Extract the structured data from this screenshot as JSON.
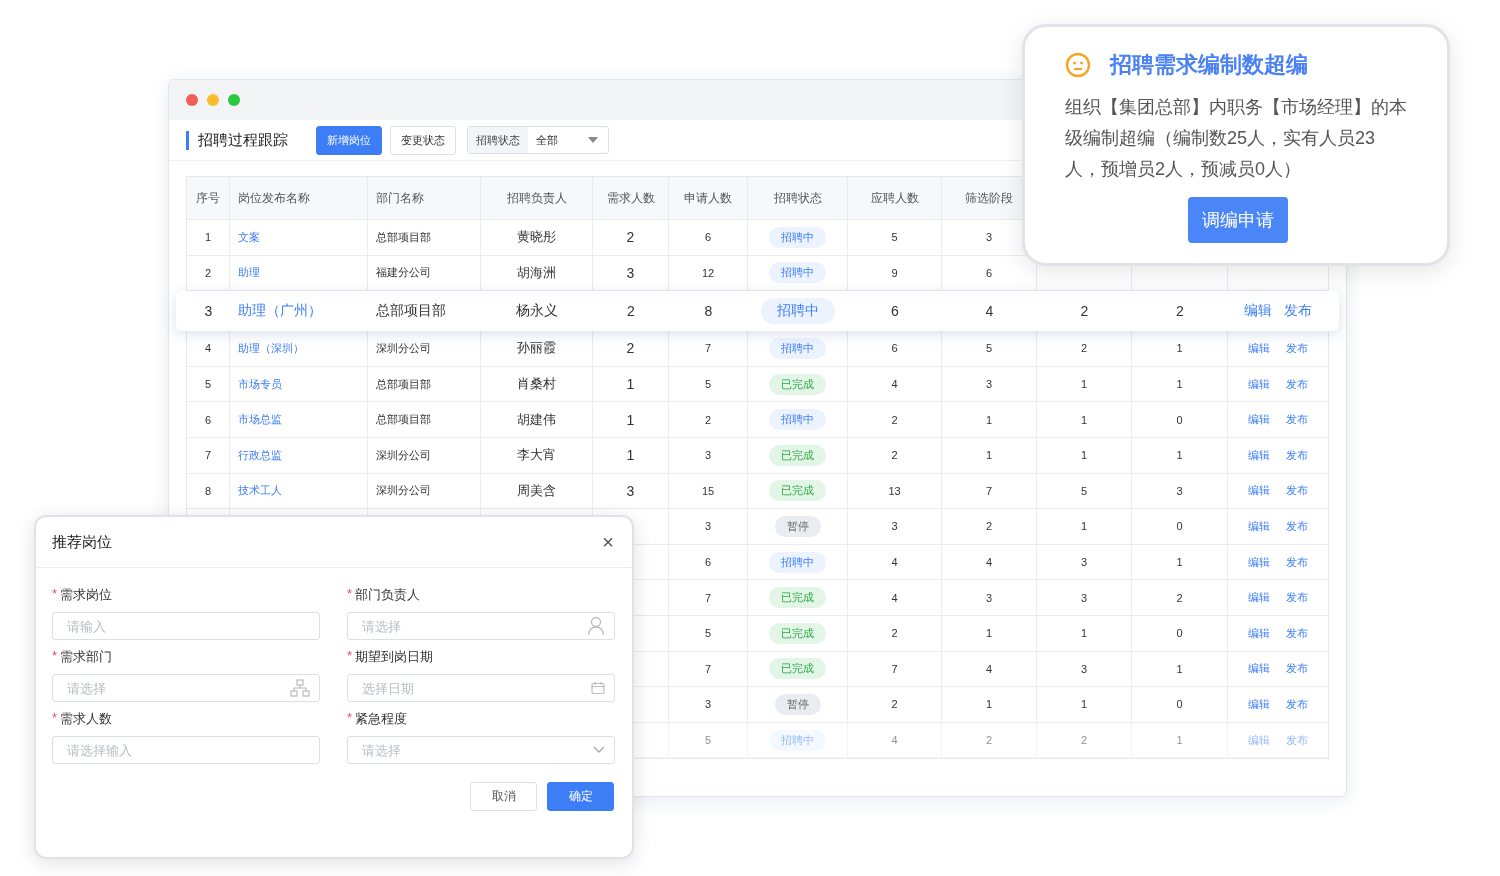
{
  "main_window": {
    "title": "招聘过程跟踪",
    "toolbar": {
      "buttons": [
        {
          "label": "新增岗位",
          "kind": "primary"
        },
        {
          "label": "变更状态",
          "kind": "default"
        }
      ],
      "filter": {
        "label": "招聘状态",
        "value": "全部"
      }
    },
    "table": {
      "columns": [
        "序号",
        "岗位发布名称",
        "部门名称",
        "招聘负责人",
        "需求人数",
        "申请人数",
        "招聘状态",
        "应聘人数",
        "筛选阶段"
      ],
      "rows": [
        {
          "no": "1",
          "name": "文案",
          "dept": "总部项目部",
          "owner": "黄晓彤",
          "demand": "2",
          "applied": "6",
          "status": {
            "text": "招聘中",
            "kind": "active"
          },
          "applicants": "5",
          "screening": "3",
          "featured": false,
          "dimmed": false
        },
        {
          "no": "2",
          "name": "助理",
          "dept": "福建分公司",
          "owner": "胡海洲",
          "demand": "3",
          "applied": "12",
          "status": {
            "text": "招聘中",
            "kind": "active"
          },
          "applicants": "9",
          "screening": "6",
          "featured": false,
          "dimmed": false
        },
        {
          "no": "3",
          "name": "助理（广州）",
          "dept": "总部项目部",
          "owner": "杨永义",
          "demand": "2",
          "applied": "8",
          "status": {
            "text": "招聘中",
            "kind": "active"
          },
          "applicants": "6",
          "screening": "4",
          "column_10": "2",
          "column_11": "2",
          "actions": [
            "编辑",
            "发布"
          ],
          "featured": true,
          "dimmed": false
        },
        {
          "no": "4",
          "name": "助理（深圳）",
          "dept": "深圳分公司",
          "owner": "孙丽霞",
          "demand": "2",
          "applied": "7",
          "status": {
            "text": "招聘中",
            "kind": "active"
          },
          "applicants": "6",
          "screening": "5",
          "column_10": "2",
          "column_11": "1",
          "actions": [
            "编辑",
            "发布"
          ],
          "featured": false,
          "dimmed": false
        },
        {
          "no": "5",
          "name": "市场专员",
          "dept": "总部项目部",
          "owner": "肖桑村",
          "demand": "1",
          "applied": "5",
          "status": {
            "text": "已完成",
            "kind": "done"
          },
          "applicants": "4",
          "screening": "3",
          "column_10": "1",
          "column_11": "1",
          "actions": [
            "编辑",
            "发布"
          ],
          "featured": false,
          "dimmed": false
        },
        {
          "no": "6",
          "name": "市场总监",
          "dept": "总部项目部",
          "owner": "胡建伟",
          "demand": "1",
          "applied": "2",
          "status": {
            "text": "招聘中",
            "kind": "active"
          },
          "applicants": "2",
          "screening": "1",
          "column_10": "1",
          "column_11": "0",
          "actions": [
            "编辑",
            "发布"
          ],
          "featured": false,
          "dimmed": false
        },
        {
          "no": "7",
          "name": "行政总监",
          "dept": "深圳分公司",
          "owner": "李大宵",
          "demand": "1",
          "applied": "3",
          "status": {
            "text": "已完成",
            "kind": "done"
          },
          "applicants": "2",
          "screening": "1",
          "column_10": "1",
          "column_11": "1",
          "actions": [
            "编辑",
            "发布"
          ],
          "featured": false,
          "dimmed": false
        },
        {
          "no": "8",
          "name": "技术工人",
          "dept": "深圳分公司",
          "owner": "周美含",
          "demand": "3",
          "applied": "15",
          "status": {
            "text": "已完成",
            "kind": "done"
          },
          "applicants": "13",
          "screening": "7",
          "column_10": "5",
          "column_11": "3",
          "actions": [
            "编辑",
            "发布"
          ],
          "featured": false,
          "dimmed": false
        },
        {
          "applied": "3",
          "status": {
            "text": "暂停",
            "kind": "paused"
          },
          "applicants": "3",
          "screening": "2",
          "column_10": "1",
          "column_11": "0",
          "actions": [
            "编辑",
            "发布"
          ],
          "featured": false,
          "dimmed": false
        },
        {
          "applied": "6",
          "status": {
            "text": "招聘中",
            "kind": "active"
          },
          "applicants": "4",
          "screening": "4",
          "column_10": "3",
          "column_11": "1",
          "actions": [
            "编辑",
            "发布"
          ],
          "featured": false,
          "dimmed": false
        },
        {
          "applied": "7",
          "status": {
            "text": "已完成",
            "kind": "done"
          },
          "applicants": "4",
          "screening": "3",
          "column_10": "3",
          "column_11": "2",
          "actions": [
            "编辑",
            "发布"
          ],
          "featured": false,
          "dimmed": false
        },
        {
          "applied": "5",
          "status": {
            "text": "已完成",
            "kind": "done"
          },
          "applicants": "2",
          "screening": "1",
          "column_10": "1",
          "column_11": "0",
          "actions": [
            "编辑",
            "发布"
          ],
          "featured": false,
          "dimmed": false
        },
        {
          "applied": "7",
          "status": {
            "text": "已完成",
            "kind": "done"
          },
          "applicants": "7",
          "screening": "4",
          "column_10": "3",
          "column_11": "1",
          "actions": [
            "编辑",
            "发布"
          ],
          "featured": false,
          "dimmed": false
        },
        {
          "applied": "3",
          "status": {
            "text": "暂停",
            "kind": "paused"
          },
          "applicants": "2",
          "screening": "1",
          "column_10": "1",
          "column_11": "0",
          "actions": [
            "编辑",
            "发布"
          ],
          "featured": false,
          "dimmed": false
        },
        {
          "applied": "5",
          "status": {
            "text": "招聘中",
            "kind": "active"
          },
          "applicants": "4",
          "screening": "2",
          "column_10": "2",
          "column_11": "1",
          "actions": [
            "编辑",
            "发布"
          ],
          "featured": false,
          "dimmed": true
        }
      ]
    }
  },
  "alert_card": {
    "title": "招聘需求编制数超编",
    "message": "组织【集团总部】内职务【市场经理】的本级编制超编（编制数25人，实有人员23人，预增员2人，预减员0人）",
    "button": "调编申请"
  },
  "dialog": {
    "title": "推荐岗位",
    "close": "×",
    "fields": [
      {
        "label": "需求岗位",
        "mark": "*",
        "placeholder": "请输入",
        "kind": "text"
      },
      {
        "label": "部门负责人",
        "mark": "*",
        "placeholder": "请选择",
        "kind": "person"
      },
      {
        "label": "需求部门",
        "mark": "*",
        "placeholder": "请选择",
        "kind": "org"
      },
      {
        "label": "期望到岗日期",
        "mark": "*",
        "placeholder": "选择日期",
        "kind": "date"
      },
      {
        "label": "需求人数",
        "mark": "*",
        "placeholder": "请选择输入",
        "kind": "text"
      },
      {
        "label": "紧急程度",
        "mark": "*",
        "placeholder": "请选择",
        "kind": "select"
      }
    ],
    "buttons": [
      {
        "label": "取消",
        "kind": "default"
      },
      {
        "label": "确定",
        "kind": "primary"
      }
    ]
  }
}
